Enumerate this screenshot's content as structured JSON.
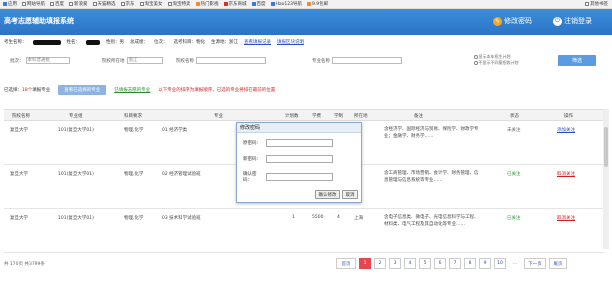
{
  "bookmarks": [
    "应用",
    "网站导航",
    "百度",
    "新浪爱",
    "天猫精选",
    "京东",
    "淘宝美女",
    "淘宝特卖",
    "热门影视",
    "京东商城",
    "百度",
    "Hao123导航",
    "9.9包邮"
  ],
  "bookmarks_right": "其他书签",
  "header": {
    "title": "高考志愿辅助填报系统",
    "change_password": "修改密码",
    "logout": "注销登录"
  },
  "userinfo": {
    "candidate_label": "考生名称：",
    "name_label": "姓名：",
    "gender": "性别：男",
    "score_label": "总成绩：",
    "rank": "位次：",
    "plan": "选考科目：物化",
    "province": "生源地：浙江",
    "link1": "查看填报记录",
    "link2": "填报区块说明"
  },
  "filter": {
    "batch_label": "批次：",
    "batch_value": "本科普通批",
    "province_label": "院校所在地",
    "province_value": "浙江",
    "school_label": "院校名称",
    "major_label": "专业名称",
    "check1": "显示本年招生计划",
    "check2": "不显示不同意招收计划",
    "button": "筛选"
  },
  "notice": {
    "count_text": "已选择：",
    "count_num": "18个",
    "count_suffix": "填报专业",
    "view_button": "查看已选择的专业",
    "link": "已填报志愿的专业",
    "warning": "以下专业的排序为填报顺序，已选的专业将排在最前的位置"
  },
  "table": {
    "headers": [
      "院校名称",
      "专业组",
      "科目要求",
      "专业",
      "计划数",
      "学费",
      "学制",
      "所在地",
      "备注",
      "状态",
      "操作"
    ],
    "rows": [
      {
        "school": "复旦大学",
        "group": "101(复旦大学01)",
        "req": "物理,化学",
        "major": "01 经济学类",
        "plan": "",
        "fee": "",
        "years": "",
        "city": "",
        "note": "含经济学、国际经济与贸易、保险学、财政学专业；金融学、财务学……",
        "status": "未关注",
        "op": "添加关注"
      },
      {
        "school": "复旦大学",
        "group": "101(复旦大学01)",
        "req": "物理,化学",
        "major": "02 经济管理试验班",
        "plan": "",
        "fee": "",
        "years": "",
        "city": "",
        "note": "含工商管理、市场营销、会计学、财务管理、信息管理与信息系统等专业……",
        "status": "已关注",
        "op": "取消关注"
      },
      {
        "school": "复旦大学",
        "group": "101(复旦大学01)",
        "req": "物理,化学",
        "major": "03 技术科学试验班",
        "plan": "1",
        "fee": "5500",
        "years": "4",
        "city": "上海",
        "note": "含电子信息类、微电子、光电信息科学与工程、材料类、电气工程及其自动化等专业……",
        "status": "已关注",
        "op": "取消关注"
      }
    ]
  },
  "dialog": {
    "title": "修改密码",
    "old_label": "原密码：",
    "new_label": "新密码：",
    "confirm_label": "确认密码：",
    "ok": "确认修改",
    "cancel": "取消"
  },
  "footer": {
    "count": "共 170页   共3799条",
    "pages": [
      "首页",
      "1",
      "2",
      "3",
      "4",
      "5",
      "6",
      "7",
      "8",
      "9",
      "10",
      "...",
      "下一页",
      "尾页"
    ],
    "current_page": "1"
  }
}
